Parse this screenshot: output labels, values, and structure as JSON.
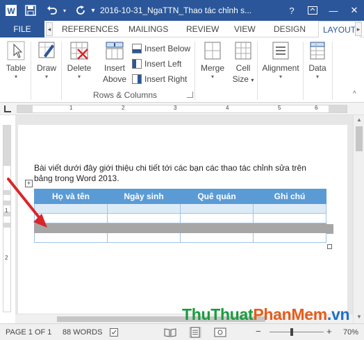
{
  "titlebar": {
    "title": "2016-10-31_NgaTTN_Thao tác chỉnh s...",
    "help": "?",
    "minimize": "—",
    "close": "✕"
  },
  "tabs": {
    "file": "FILE",
    "references": "REFERENCES",
    "mailings": "MAILINGS",
    "review": "REVIEW",
    "view": "VIEW",
    "design": "DESIGN",
    "layout": "LAYOUT"
  },
  "ribbon": {
    "table": "Table",
    "draw": "Draw",
    "delete": "Delete",
    "insert_above_1": "Insert",
    "insert_above_2": "Above",
    "insert_below": "Insert Below",
    "insert_left": "Insert Left",
    "insert_right": "Insert Right",
    "merge": "Merge",
    "cell_size_1": "Cell",
    "cell_size_2": "Size",
    "alignment": "Alignment",
    "data": "Data",
    "group_rows_columns": "Rows & Columns"
  },
  "ruler": {
    "n1": "1",
    "n2": "2",
    "n3": "3",
    "n4": "4",
    "n5": "5",
    "n6": "6"
  },
  "vruler": {
    "n1": "1",
    "n2": "2"
  },
  "document": {
    "paragraph": "Bài viết dưới đây giới thiệu chi tiết tới các bạn các thao tác chỉnh sửa trên bảng trong Word 2013.",
    "table_headers": [
      "Họ và tên",
      "Ngày sinh",
      "Quê quán",
      "Ghi chú"
    ]
  },
  "watermark": {
    "part1": "ThuThuat",
    "part2": "PhanMem",
    "part3": ".vn"
  },
  "statusbar": {
    "page": "PAGE 1 OF 1",
    "words": "88 WORDS",
    "zoom": "70%",
    "minus": "−",
    "plus": "+"
  },
  "colors": {
    "word_blue": "#2b579a",
    "table_header": "#5b9bd5",
    "table_band": "#ddebf7",
    "selection": "#a6a6a6",
    "arrow": "#d9252a"
  }
}
